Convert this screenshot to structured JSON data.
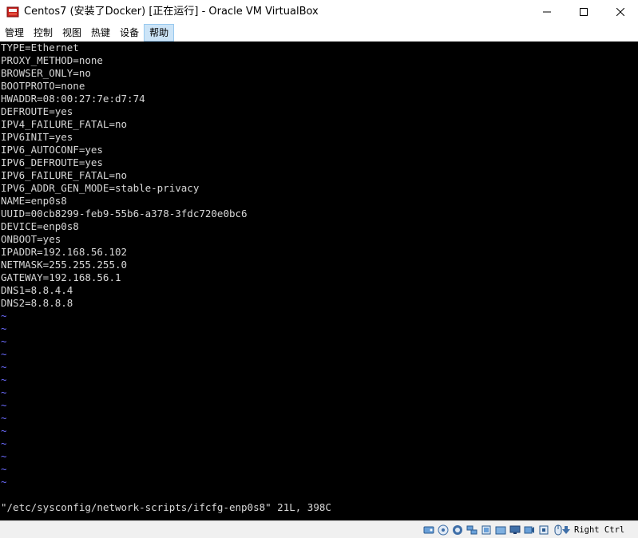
{
  "window": {
    "title": "Centos7 (安装了Docker) [正在运行] - Oracle VM VirtualBox",
    "minimize_symbol": "—",
    "maximize_symbol": "☐",
    "close_symbol": "✕"
  },
  "menubar": {
    "items": [
      "管理",
      "控制",
      "视图",
      "热键",
      "设备",
      "帮助"
    ],
    "active_index": 5
  },
  "console": {
    "lines": [
      "TYPE=Ethernet",
      "PROXY_METHOD=none",
      "BROWSER_ONLY=no",
      "BOOTPROTO=none",
      "HWADDR=08:00:27:7e:d7:74",
      "DEFROUTE=yes",
      "IPV4_FAILURE_FATAL=no",
      "IPV6INIT=yes",
      "IPV6_AUTOCONF=yes",
      "IPV6_DEFROUTE=yes",
      "IPV6_FAILURE_FATAL=no",
      "IPV6_ADDR_GEN_MODE=stable-privacy",
      "NAME=enp0s8",
      "UUID=00cb8299-feb9-55b6-a378-3fdc720e0bc6",
      "DEVICE=enp0s8",
      "ONBOOT=yes",
      "IPADDR=192.168.56.102",
      "NETMASK=255.255.255.0",
      "GATEWAY=192.168.56.1",
      "DNS1=8.8.4.4",
      "DNS2=8.8.8.8"
    ],
    "tilde_symbol": "~",
    "tilde_count": 14,
    "status_line": "\"/etc/sysconfig/network-scripts/ifcfg-enp0s8\" 21L, 398C",
    "text_color": "#d8d8d8",
    "tilde_color": "#6b6bff",
    "background": "#000000"
  },
  "statusbar": {
    "icons": [
      "hard-disk-icon",
      "optical-drive-icon",
      "audio-icon",
      "network-icon",
      "usb-icon",
      "shared-folders-icon",
      "display-icon",
      "recording-icon",
      "cpu-icon",
      "mouse-integration-icon",
      "host-key-arrow-icon"
    ],
    "host_key": "Right Ctrl"
  }
}
